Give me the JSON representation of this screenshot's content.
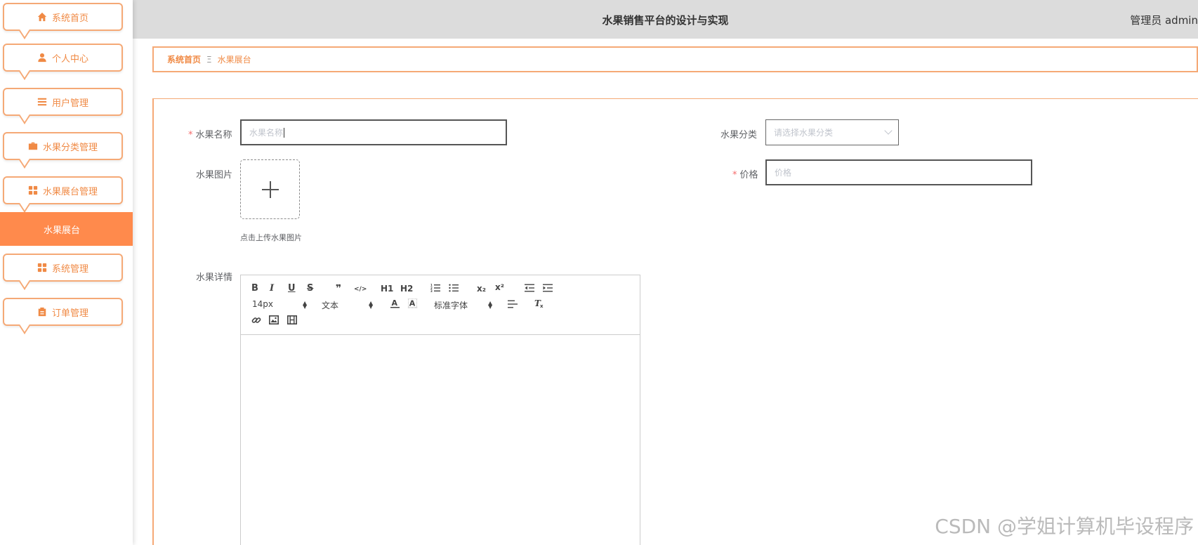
{
  "header": {
    "title": "水果销售平台的设计与实现",
    "user": "管理员 admin"
  },
  "sidebar": {
    "items": [
      {
        "label": "系统首页",
        "icon": "home-icon"
      },
      {
        "label": "个人中心",
        "icon": "user-icon"
      },
      {
        "label": "用户管理",
        "icon": "list-icon"
      },
      {
        "label": "水果分类管理",
        "icon": "briefcase-icon"
      },
      {
        "label": "水果展台管理",
        "icon": "grid-icon"
      },
      {
        "label": "水果展台",
        "active": true
      },
      {
        "label": "系统管理",
        "icon": "grid-icon"
      },
      {
        "label": "订单管理",
        "icon": "clipboard-icon"
      }
    ]
  },
  "breadcrumb": {
    "home": "系统首页",
    "separator": "Ξ",
    "current": "水果展台"
  },
  "form": {
    "name": {
      "label": "水果名称",
      "placeholder": "水果名称",
      "required": true
    },
    "category": {
      "label": "水果分类",
      "placeholder": "请选择水果分类"
    },
    "image": {
      "label": "水果图片",
      "tip": "点击上传水果图片"
    },
    "price": {
      "label": "价格",
      "placeholder": "价格",
      "required": true
    },
    "detail": {
      "label": "水果详情"
    }
  },
  "editor": {
    "font_size": "14px",
    "header_select": "文本",
    "font_family": "标准字体",
    "buttons": {
      "bold": "B",
      "italic": "I",
      "underline": "U",
      "strike": "S",
      "quote": "❞",
      "code": "</>",
      "h1": "H1",
      "h2": "H2",
      "sub": "x₂",
      "sup": "x²"
    }
  },
  "watermark": "CSDN @学姐计算机毕设程序",
  "colors": {
    "accent": "#ff8a4c",
    "border": "#f5a976",
    "header_bg": "#dcdcdc"
  }
}
